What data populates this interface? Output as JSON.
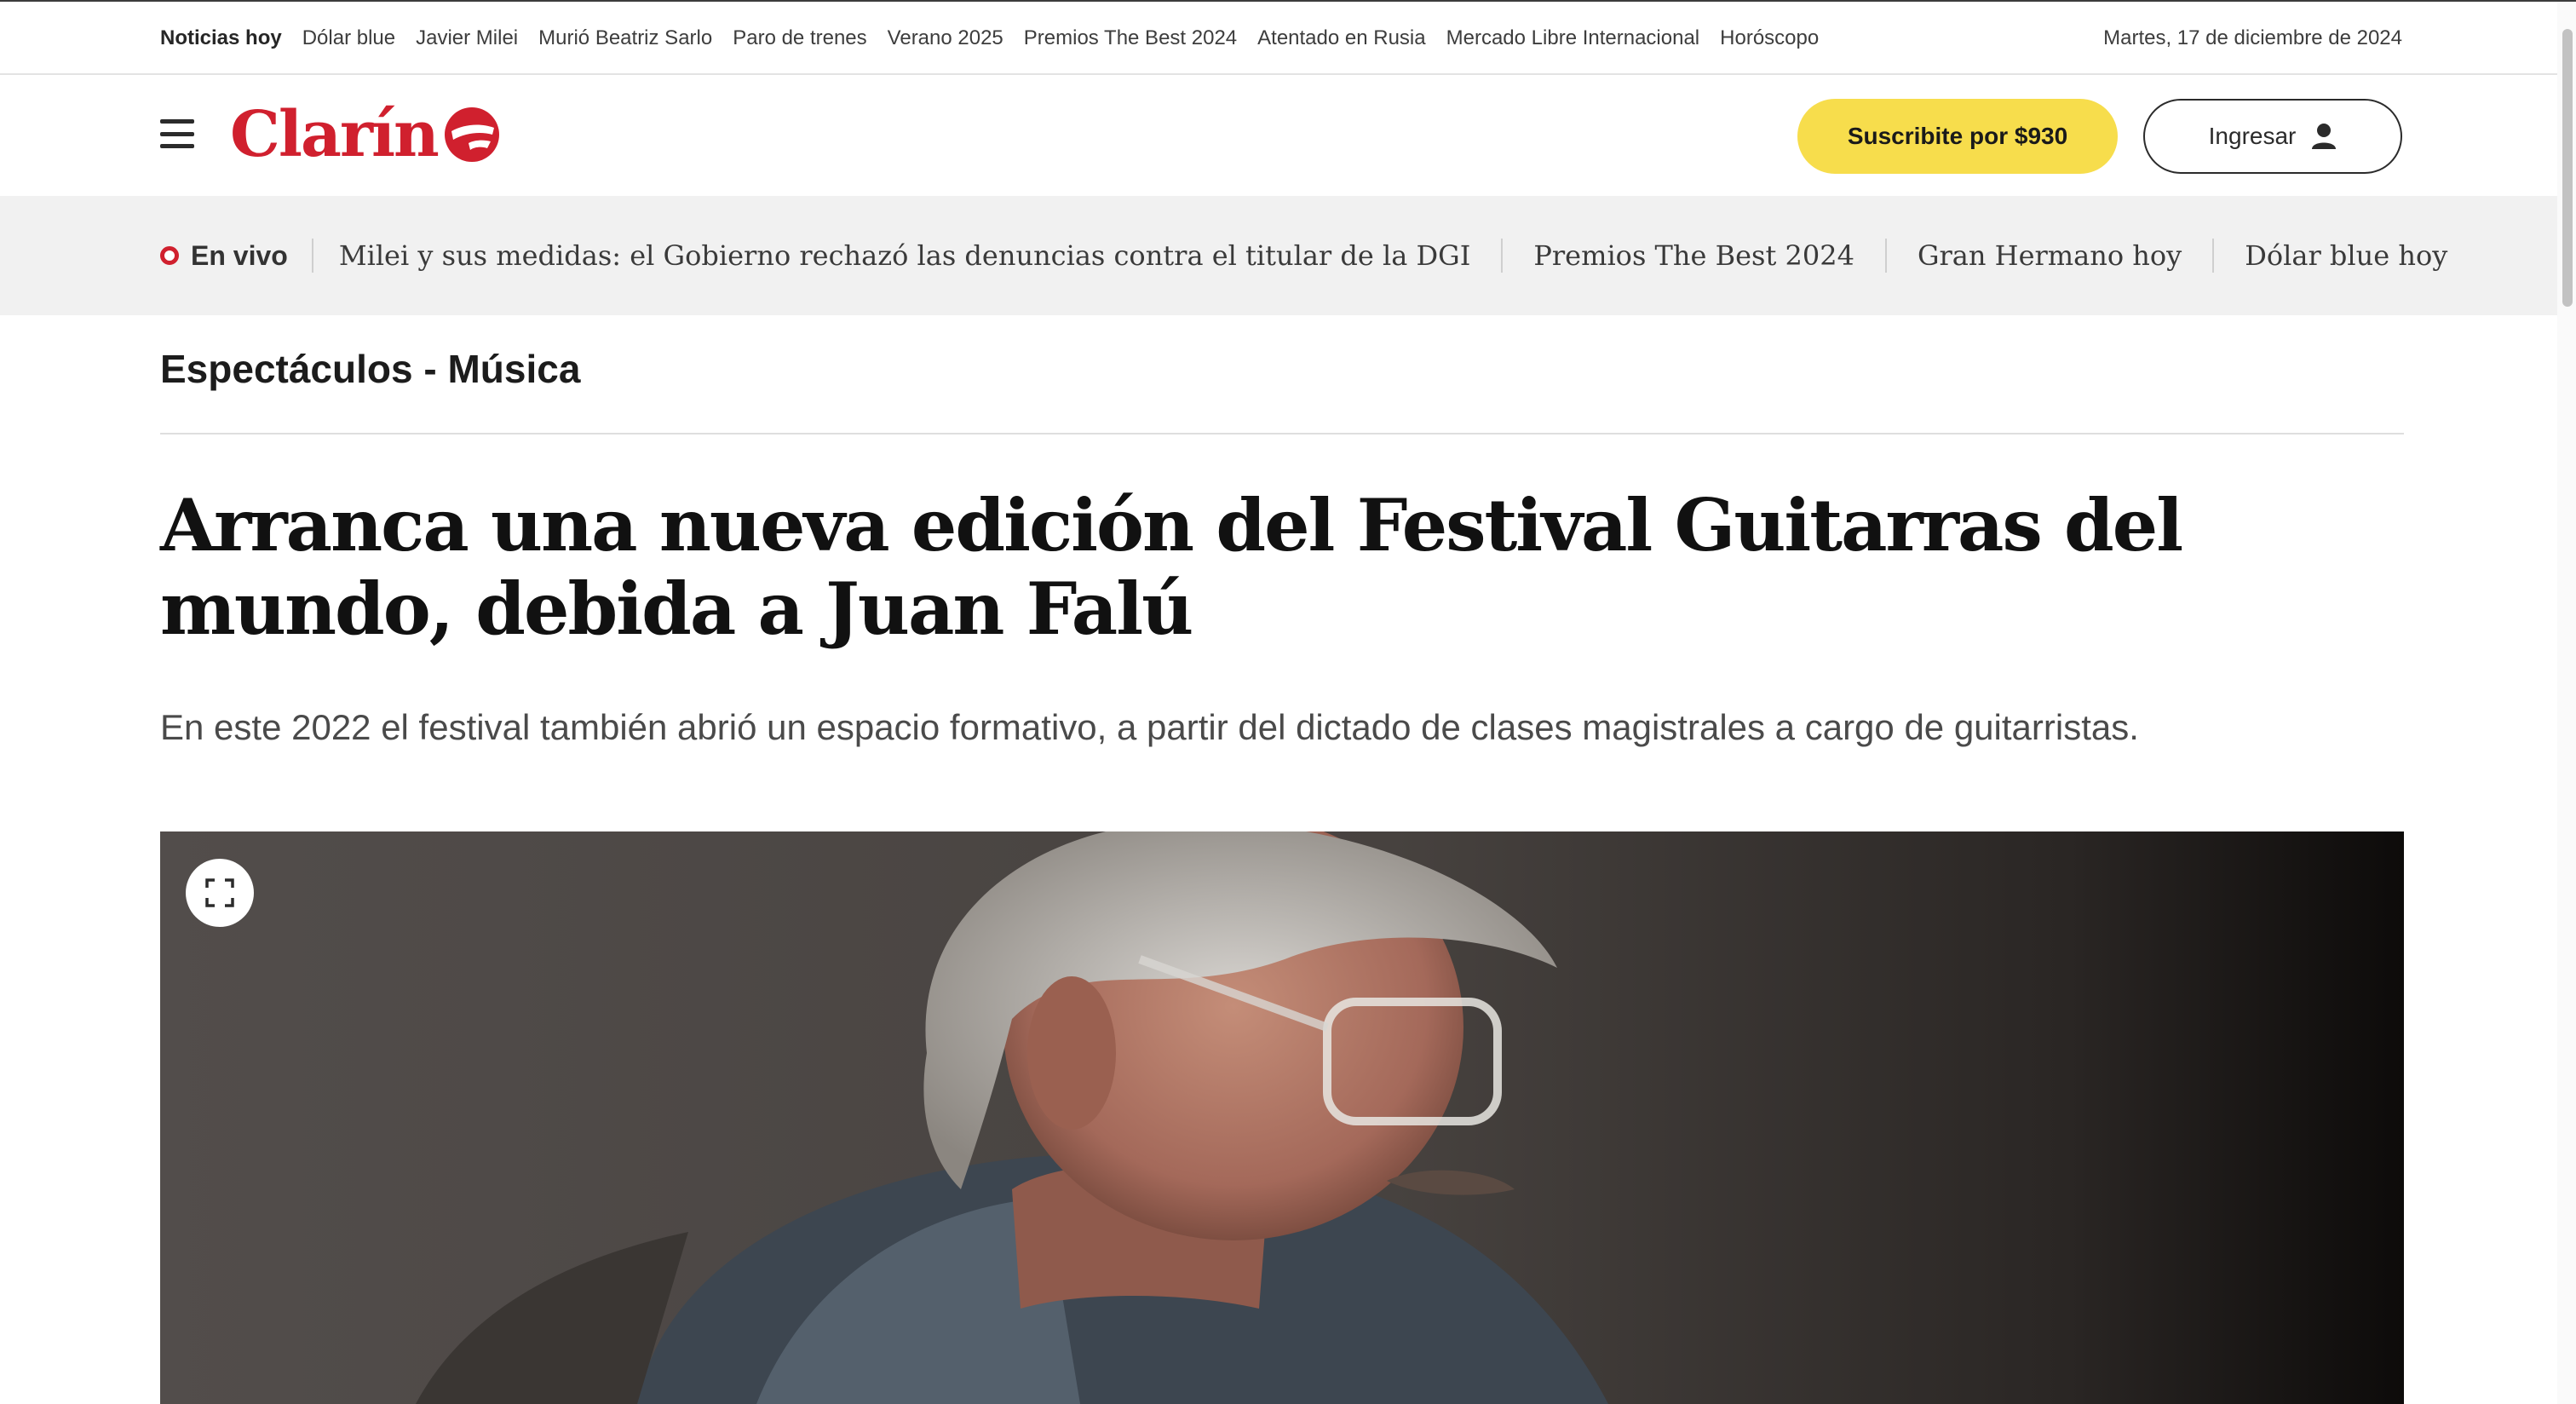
{
  "topbar": {
    "links": [
      "Noticias hoy",
      "Dólar blue",
      "Javier Milei",
      "Murió Beatriz Sarlo",
      "Paro de trenes",
      "Verano 2025",
      "Premios The Best 2024",
      "Atentado en Rusia",
      "Mercado Libre Internacional",
      "Horóscopo"
    ],
    "date": "Martes, 17 de diciembre de 2024"
  },
  "header": {
    "logo_text": "Clarín",
    "subscribe_label": "Suscribite por $930",
    "login_label": "Ingresar",
    "brand_color": "#d0202e",
    "subscribe_color": "#f7dd4c"
  },
  "livebar": {
    "live_label": "En vivo",
    "items": [
      "Milei y sus medidas: el Gobierno rechazó las denuncias contra el titular de la DGI",
      "Premios The Best 2024",
      "Gran Hermano hoy",
      "Dólar blue hoy"
    ]
  },
  "article": {
    "section": "Espectáculos - Música",
    "headline": "Arranca una nueva edición del Festival Guitarras del mundo, debida a Juan Falú",
    "subhead": "En este 2022 el festival también abrió un espacio formativo, a partir del dictado de clases magistrales a cargo de guitarristas."
  },
  "icons": {
    "menu": "hamburger-icon",
    "user": "user-icon",
    "expand": "expand-icon",
    "live": "live-dot-icon"
  }
}
